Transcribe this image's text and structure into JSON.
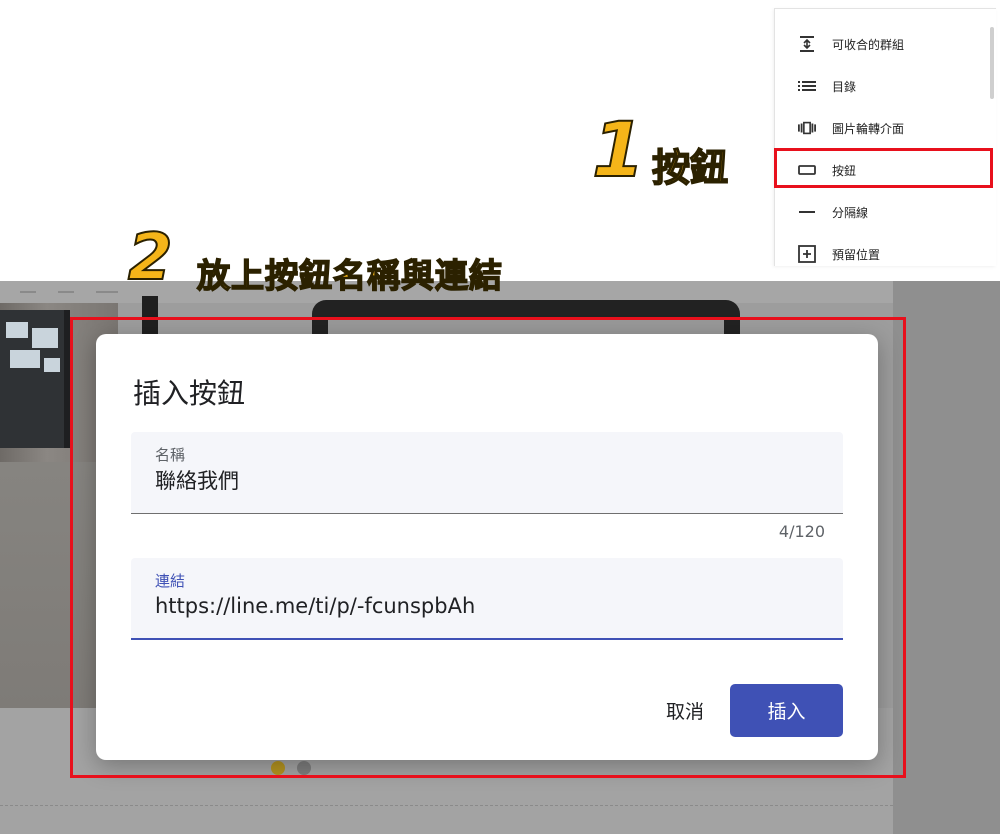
{
  "menu": {
    "items": [
      {
        "label": "可收合的群組",
        "icon": "collapsible-group-icon"
      },
      {
        "label": "目錄",
        "icon": "table-of-contents-icon"
      },
      {
        "label": "圖片輪轉介面",
        "icon": "image-carousel-icon"
      },
      {
        "label": "按鈕",
        "icon": "button-icon"
      },
      {
        "label": "分隔線",
        "icon": "divider-icon"
      },
      {
        "label": "預留位置",
        "icon": "placeholder-icon"
      }
    ]
  },
  "annotations": {
    "step1_number": "1",
    "step1_text": "按鈕",
    "step2_number": "2",
    "step2_text": "放上按鈕名稱與連結",
    "highlight_color": "#e8101c",
    "callout_color": "#f5b519"
  },
  "dialog": {
    "title": "插入按鈕",
    "name_field": {
      "label": "名稱",
      "value": "聯絡我們",
      "counter": "4/120"
    },
    "link_field": {
      "label": "連結",
      "value": "https://line.me/ti/p/-fcunspbAh"
    },
    "cancel_label": "取消",
    "insert_label": "插入",
    "accent_color": "#3f51b5"
  }
}
